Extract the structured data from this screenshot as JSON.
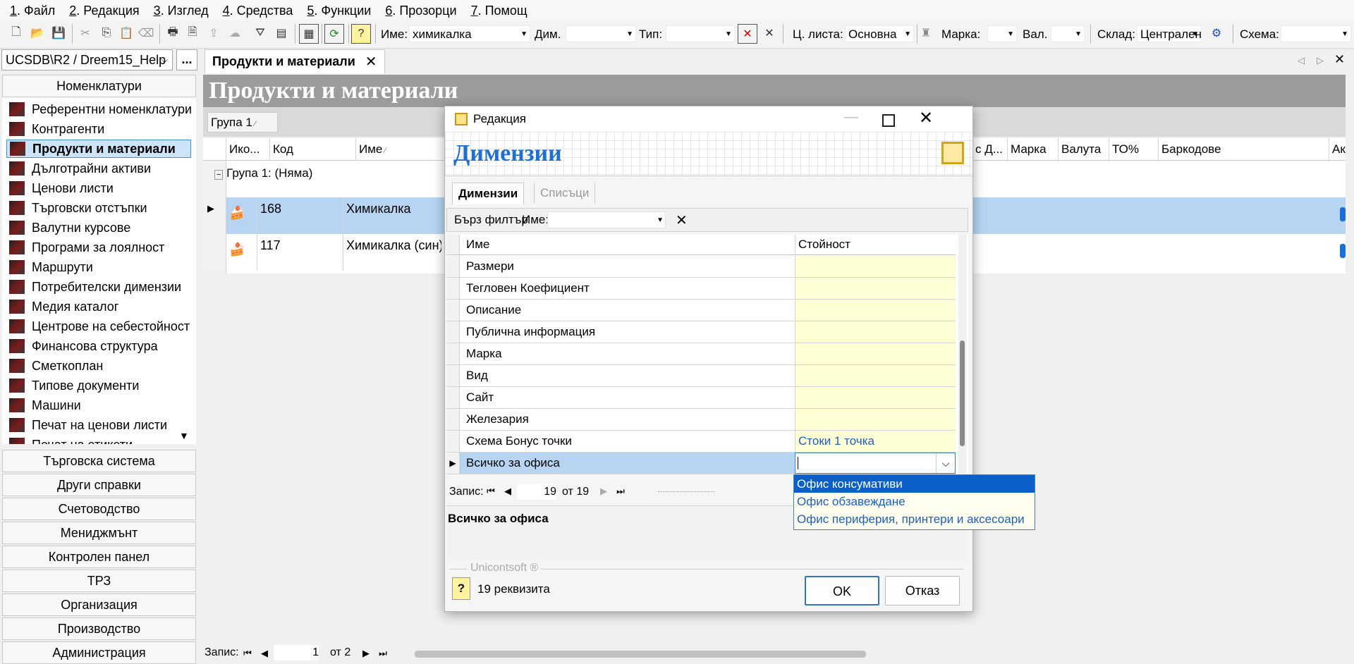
{
  "menu": [
    {
      "num": "1",
      "label": ". Файл"
    },
    {
      "num": "2",
      "label": ". Редакция"
    },
    {
      "num": "3",
      "label": ". Изглед"
    },
    {
      "num": "4",
      "label": ". Средства"
    },
    {
      "num": "5",
      "label": ". Функции"
    },
    {
      "num": "6",
      "label": ". Прозорци"
    },
    {
      "num": "7",
      "label": ". Помощ"
    }
  ],
  "toolbar": {
    "name_label": "Име:",
    "name_value": "химикалка",
    "dim_label": "Дим.",
    "dim_value": "",
    "type_label": "Тип:",
    "type_value": "",
    "pricelist_label": "Ц. листа:",
    "pricelist_value": "Основна",
    "brand_label": "Марка:",
    "brand_value": "",
    "currency_label": "Вал.",
    "currency_value": "",
    "warehouse_label": "Склад:",
    "warehouse_value": "Централен",
    "scheme_label": "Схема:",
    "scheme_value": ""
  },
  "db_selector": {
    "value": "UCSDB\\R2 / Dreem15_Help",
    "more": "..."
  },
  "nav": {
    "header": "Номенклатури",
    "items": [
      "Референтни номенклатури",
      "Контрагенти",
      "Продукти и материали",
      "Дълготрайни активи",
      "Ценови листи",
      "Търговски отстъпки",
      "Валутни курсове",
      "Програми за лоялност",
      "Маршрути",
      "Потребителски димензии",
      "Медия каталог",
      "Центрове на себестойност",
      "Финансова структура",
      "Сметкоплан",
      "Типове документи",
      "Машини",
      "Печат на ценови листи",
      "Печат на етикети"
    ],
    "selected_index": 2,
    "sections": [
      "Търговска система",
      "Други справки",
      "Счетоводство",
      "Мениджмънт",
      "Контролен панел",
      "ТРЗ",
      "Организация",
      "Производство",
      "Администрация"
    ]
  },
  "main": {
    "tab_label": "Продукти и материали",
    "title": "Продукти и материали",
    "group_chip": "Група 1",
    "columns": [
      "Ико...",
      "Код",
      "Име",
      "с Д...",
      "Марка",
      "Валута",
      "ТО%",
      "Баркодове",
      "Акт"
    ],
    "group_row": "Група 1: (Няма)",
    "rows": [
      {
        "code": "168",
        "name": "Химикалка"
      },
      {
        "code": "117",
        "name": "Химикалка (син)"
      }
    ],
    "record_label": "Запис:",
    "record_current": "1",
    "record_of": "от 2"
  },
  "dialog": {
    "title": "Редакция",
    "heading": "Димензии",
    "tabs": [
      "Димензии",
      "Списъци"
    ],
    "filter_label": "Бърз филтър",
    "filter_name_label": "Име:",
    "filter_name_value": "",
    "col_name": "Име",
    "col_value": "Стойност",
    "rows": [
      {
        "name": "Размери",
        "value": ""
      },
      {
        "name": "Тегловен Коефициент",
        "value": ""
      },
      {
        "name": "Описание",
        "value": ""
      },
      {
        "name": "Публична информация",
        "value": ""
      },
      {
        "name": "Марка",
        "value": ""
      },
      {
        "name": "Вид",
        "value": ""
      },
      {
        "name": "Сайт",
        "value": ""
      },
      {
        "name": "Железария",
        "value": ""
      },
      {
        "name": "Схема Бонус точки",
        "value": "Стоки 1 точка"
      },
      {
        "name": "Всичко за офиса",
        "value": ""
      }
    ],
    "dropdown_options": [
      "Офис консумативи",
      "Офис обзавеждане",
      "Офис периферия, принтери и аксесоари"
    ],
    "record_label": "Запис:",
    "record_current": "19",
    "record_of": "от 19",
    "description": "Всичко за офиса",
    "brand": "Unicontsoft ®",
    "count_text": "19 реквизита",
    "ok": "OK",
    "cancel": "Отказ"
  }
}
